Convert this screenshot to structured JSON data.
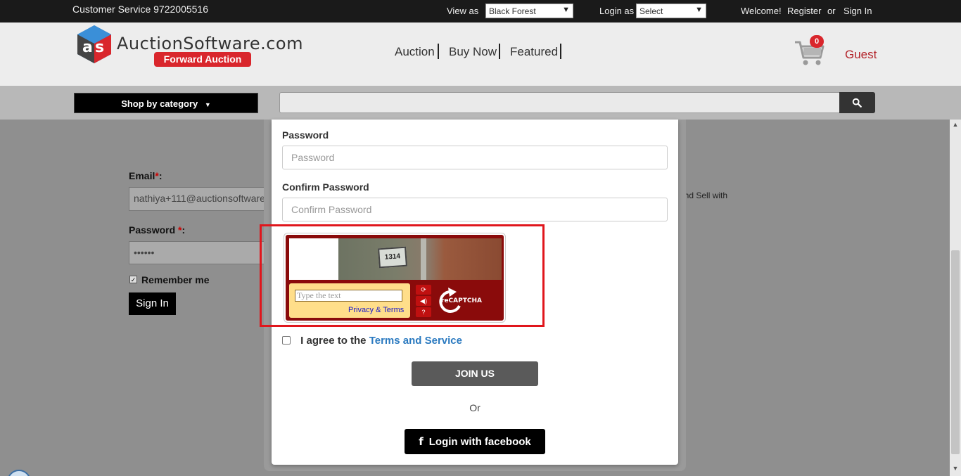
{
  "topbar": {
    "customer_service": "Customer Service 9722005516",
    "view_as_label": "View as",
    "view_as_value": "Black Forest",
    "login_as_label": "Login as",
    "login_as_value": "Select",
    "welcome": "Welcome!",
    "register": "Register",
    "or": "or",
    "sign_in": "Sign In"
  },
  "header": {
    "logo_text": "AuctionSoftware.com",
    "logo_sub": "Forward Auction",
    "nav": [
      "Auction",
      "Buy Now",
      "Featured"
    ],
    "cart_count": "0",
    "user": "Guest"
  },
  "category_bar": {
    "shop_by_category": "Shop by category",
    "search_placeholder": ""
  },
  "background_login": {
    "email_label": "Email",
    "email_value": "nathiya+111@auctionsoftware",
    "password_label": "Password",
    "password_value": "••••••",
    "remember_me": "Remember me",
    "sign_in_button": "Sign In",
    "side_text": "and Sell with"
  },
  "modal": {
    "password_label": "Password",
    "password_placeholder": "Password",
    "confirm_label": "Confirm Password",
    "confirm_placeholder": "Confirm Password",
    "captcha": {
      "image_text": "1314",
      "input_placeholder": "Type the text",
      "privacy_terms": "Privacy & Terms",
      "brand": "reCAPTCHA"
    },
    "agree_prefix": "I agree to the",
    "terms_link": "Terms and Service",
    "join_button": "JOIN US",
    "or_text": "Or",
    "facebook_button": "Login with facebook"
  },
  "colors": {
    "accent_red": "#d9262c",
    "captcha_red": "#8a0b0b",
    "link_blue": "#2b7ac0",
    "highlight_outline": "#e0161c"
  }
}
